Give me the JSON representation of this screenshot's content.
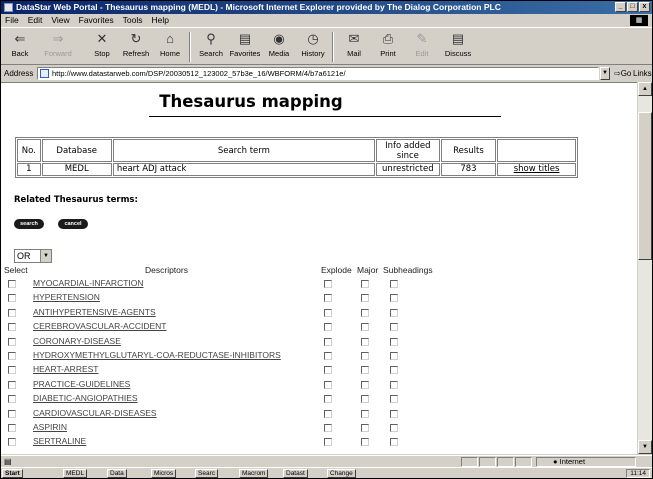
{
  "window": {
    "title": "DataStar Web Portal - Thesaurus mapping (MEDL) - Microsoft Internet Explorer provided by The Dialog Corporation PLC",
    "controls": [
      "_",
      "□",
      "x"
    ]
  },
  "menu": [
    "File",
    "Edit",
    "View",
    "Favorites",
    "Tools",
    "Help"
  ],
  "toolbar": {
    "back": "Back",
    "forward": "Forward",
    "stop": "Stop",
    "refresh": "Refresh",
    "home": "Home",
    "search": "Search",
    "favorites": "Favorites",
    "media": "Media",
    "history": "History",
    "mail": "Mail",
    "print": "Print",
    "edit": "Edit",
    "discuss": "Discuss"
  },
  "address": {
    "label": "Address",
    "url": "http://www.datastarweb.com/DSP/20030512_123002_57b3e_16/WBFORM/4/b7a6121e/",
    "go": "Go",
    "links": "Links"
  },
  "page": {
    "title": "Thesaurus mapping",
    "table": {
      "headers": [
        "No.",
        "Database",
        "Search term",
        "Info added since",
        "Results",
        ""
      ],
      "rows": [
        {
          "no": "1",
          "database": "MEDL",
          "term": "heart ADJ attack",
          "info": "unrestricted",
          "results": "783",
          "link": "show titles"
        }
      ]
    },
    "related_label": "Related Thesaurus terms:",
    "search_button": "search",
    "cancel_button": "cancel",
    "operator": "OR",
    "headers": {
      "select": "Select",
      "descriptors": "Descriptors",
      "explode": "Explode",
      "major": "Major",
      "subheadings": "Subheadings"
    },
    "descriptors": [
      "MYOCARDIAL-INFARCTION",
      "HYPERTENSION",
      "ANTIHYPERTENSIVE-AGENTS",
      "CEREBROVASCULAR-ACCIDENT",
      "CORONARY-DISEASE",
      "HYDROXYMETHYLGLUTARYL-COA-REDUCTASE-INHIBITORS",
      "HEART-ARREST",
      "PRACTICE-GUIDELINES",
      "DIABETIC-ANGIOPATHIES",
      "CARDIOVASCULAR-DISEASES",
      "ASPIRIN",
      "SERTRALINE"
    ]
  },
  "status": {
    "zone": "Internet"
  },
  "taskbar": [
    "Start",
    "MEDL",
    "Data",
    "Micros",
    "Searc",
    "Macrom",
    "Datast",
    "Change"
  ],
  "tray": "11:14"
}
